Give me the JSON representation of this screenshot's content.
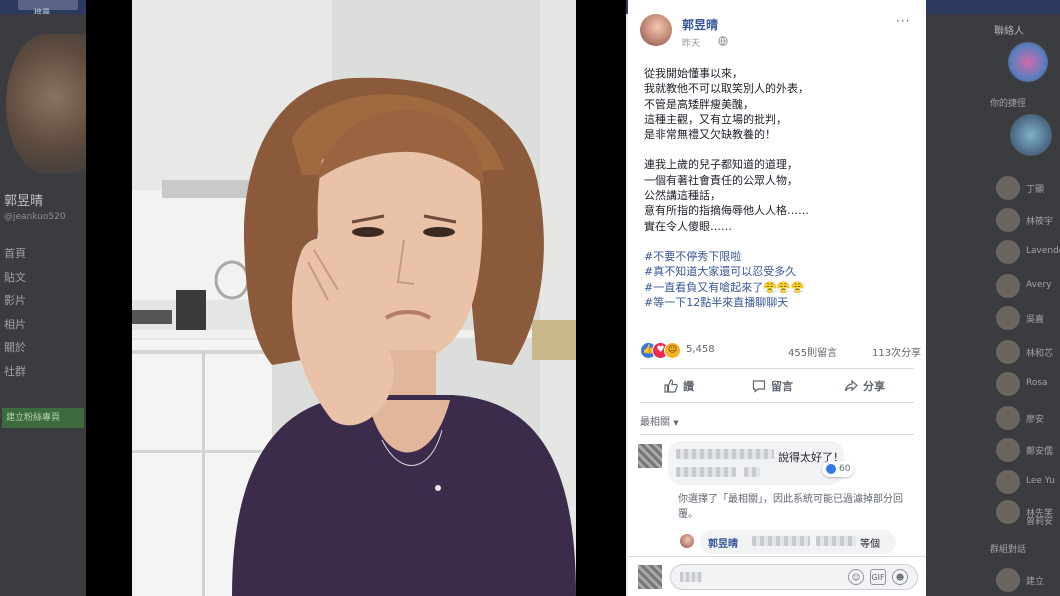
{
  "background": {
    "search_label": "搜尋",
    "profile_name": "郭昱晴",
    "profile_handle": "@jeankuo520",
    "nav_items": [
      "首頁",
      "貼文",
      "影片",
      "相片",
      "關於",
      "社群"
    ],
    "create_page_button": "建立粉絲專頁",
    "right_title": "聯絡人",
    "right_section": "你的捷徑",
    "right_section2": "群組對話",
    "friends": [
      "丁顯",
      "林筱宇",
      "Lavender",
      "Avery",
      "吳嘉",
      "林和芯",
      "Rosa",
      "廖安",
      "鄭安儒",
      "Lee Yu",
      "林先笑",
      "曾莉安",
      "建立"
    ]
  },
  "post": {
    "author": "郭昱晴",
    "time": "昨天",
    "more": "···",
    "text_lines": [
      "從我開始懂事以來，",
      "我就教他不可以取笑別人的外表，",
      "不管是高矮胖瘦美醜，",
      "這種主觀，又有立場的批判，",
      "是非常無禮又欠缺教養的！",
      "",
      "連我上歲的兒子都知道的道理，",
      "一個有著社會責任的公眾人物，",
      "公然講這種話，",
      "意有所指的指摘侮辱他人人格……",
      "實在令人傻眼……",
      ""
    ],
    "hashtags": [
      "#不要不停秀下限啦",
      "#真不知道大家還可以忍受多久",
      "#一直看負又有嗆起來了😤😤😤",
      "#等一下12點半來直播聊聊天"
    ],
    "reaction_count": "5,458",
    "comment_count": "455則留言",
    "share_count": "113次分享",
    "actions": {
      "like": "讚",
      "comment": "留言",
      "share": "分享"
    },
    "sort_label": "最相關"
  },
  "comments": {
    "first_text": "說得太好了！",
    "first_likes": "60",
    "notice": "你選擇了「最相關」，因此系統可能已過濾掉部分回覆。",
    "reply_author": "郭昱晴",
    "reply_text": "等個"
  }
}
